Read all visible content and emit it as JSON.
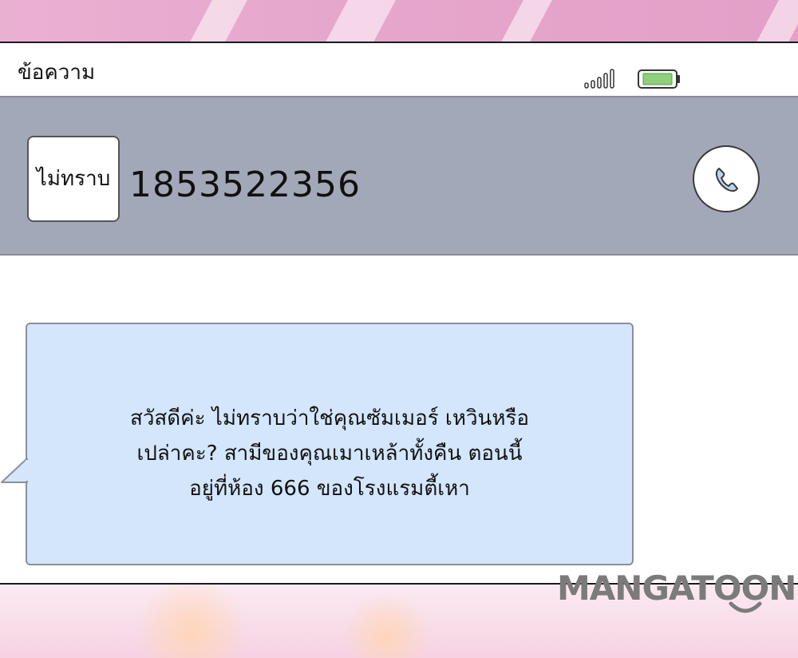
{
  "app": {
    "title": "ข้อความ"
  },
  "status": {
    "signal_icon": "signal-bars-icon",
    "battery_icon": "battery-icon",
    "battery_color": "#8fd07a"
  },
  "contact": {
    "name": "ไม่ทราบ",
    "number": "1853522356",
    "call_icon": "phone-icon"
  },
  "message": {
    "text": "สวัสดีค่ะ ไม่ทราบว่าใช่คุณซัมเมอร์ เหวินหรือ\nเปล่าคะ? สามีของคุณเมาเหล้าทั้งคืน ตอนนี้\nอยู่ที่ห้อง 666 ของโรงแรมตี้เหา",
    "bubble_color": "#d3e6fb"
  },
  "watermark": {
    "text": "MANGATOON"
  }
}
